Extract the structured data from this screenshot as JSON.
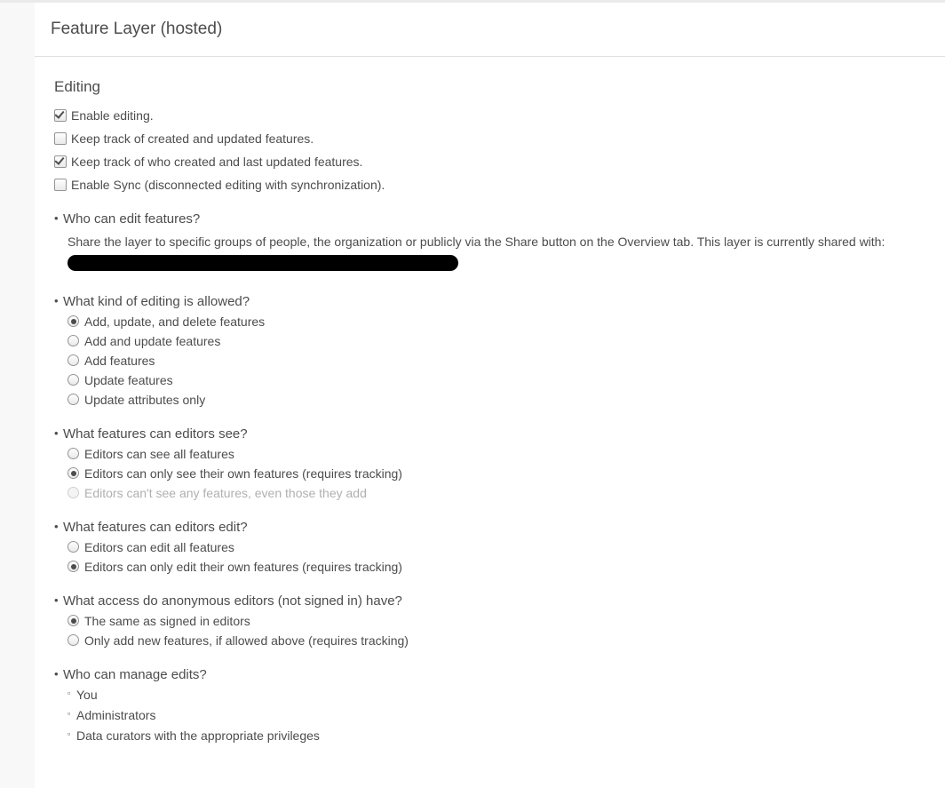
{
  "header": {
    "title": "Feature Layer (hosted)"
  },
  "editing": {
    "section_heading": "Editing",
    "checkboxes": [
      {
        "id": "enable-editing",
        "label": "Enable editing.",
        "checked": true
      },
      {
        "id": "track-created",
        "label": "Keep track of created and updated features.",
        "checked": false
      },
      {
        "id": "track-who",
        "label": "Keep track of who created and last updated features.",
        "checked": true
      },
      {
        "id": "enable-sync",
        "label": "Enable Sync (disconnected editing with synchronization).",
        "checked": false
      }
    ],
    "who_can_edit": {
      "heading": "Who can edit features?",
      "body": "Share the layer to specific groups of people, the organization or publicly via the Share button on the Overview tab. This layer is currently shared with: "
    },
    "what_kind": {
      "heading": "What kind of editing is allowed?",
      "options": [
        {
          "id": "add-update-delete",
          "label": "Add, update, and delete features",
          "selected": true,
          "disabled": false
        },
        {
          "id": "add-update",
          "label": "Add and update features",
          "selected": false,
          "disabled": false
        },
        {
          "id": "add",
          "label": "Add features",
          "selected": false,
          "disabled": false
        },
        {
          "id": "update",
          "label": "Update features",
          "selected": false,
          "disabled": false
        },
        {
          "id": "update-attrs",
          "label": "Update attributes only",
          "selected": false,
          "disabled": false
        }
      ]
    },
    "what_see": {
      "heading": "What features can editors see?",
      "options": [
        {
          "id": "see-all",
          "label": "Editors can see all features",
          "selected": false,
          "disabled": false
        },
        {
          "id": "see-own",
          "label": "Editors can only see their own features (requires tracking)",
          "selected": true,
          "disabled": false
        },
        {
          "id": "see-none",
          "label": "Editors can't see any features, even those they add",
          "selected": false,
          "disabled": true
        }
      ]
    },
    "what_edit": {
      "heading": "What features can editors edit?",
      "options": [
        {
          "id": "edit-all",
          "label": "Editors can edit all features",
          "selected": false,
          "disabled": false
        },
        {
          "id": "edit-own",
          "label": "Editors can only edit their own features (requires tracking)",
          "selected": true,
          "disabled": false
        }
      ]
    },
    "anon_access": {
      "heading": "What access do anonymous editors (not signed in) have?",
      "options": [
        {
          "id": "anon-same",
          "label": "The same as signed in editors",
          "selected": true,
          "disabled": false
        },
        {
          "id": "anon-add",
          "label": "Only add new features, if allowed above (requires tracking)",
          "selected": false,
          "disabled": false
        }
      ]
    },
    "who_manage": {
      "heading": "Who can manage edits?",
      "items": [
        "You",
        "Administrators",
        "Data curators with the appropriate privileges"
      ]
    }
  }
}
